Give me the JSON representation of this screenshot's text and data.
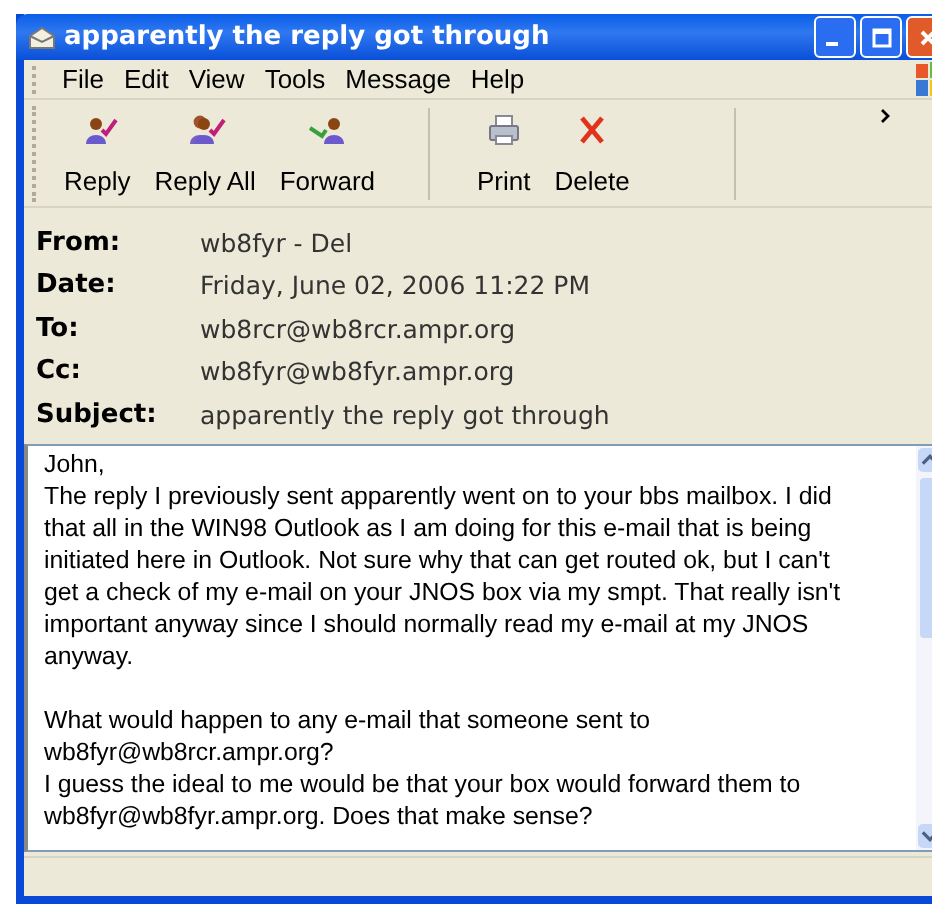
{
  "window": {
    "title": "apparently the reply got through"
  },
  "menu": [
    "File",
    "Edit",
    "View",
    "Tools",
    "Message",
    "Help"
  ],
  "toolbar": [
    {
      "label": "Reply",
      "kind": "reply",
      "separator_after": false
    },
    {
      "label": "Reply All",
      "kind": "reply_all",
      "separator_after": false
    },
    {
      "label": "Forward",
      "kind": "forward",
      "separator_after": true
    },
    {
      "label": "Print",
      "kind": "print",
      "separator_after": false
    },
    {
      "label": "Delete",
      "kind": "delete",
      "separator_after": true
    }
  ],
  "headers": [
    {
      "label": "From:",
      "value": "wb8fyr - Del"
    },
    {
      "label": "Date:",
      "value": "Friday, June 02, 2006 11:22 PM"
    },
    {
      "label": "To:",
      "value": "wb8rcr@wb8rcr.ampr.org"
    },
    {
      "label": "Cc:",
      "value": "wb8fyr@wb8fyr.ampr.org"
    },
    {
      "label": "Subject:",
      "value": "apparently the reply got through"
    }
  ],
  "body": {
    "paragraphs": [
      [
        "John,",
        "The reply I previously sent apparently went on to your bbs mailbox. I did",
        "that all in the WIN98 Outlook as I am doing for this e-mail that is being",
        "initiated here in Outlook. Not sure why that can get routed ok, but I can't",
        "get a check of my e-mail on your JNOS box via my smpt. That really isn't",
        "important anyway since I should normally read my e-mail at my JNOS",
        "anyway."
      ],
      [
        "What would happen to any e-mail that someone sent to",
        "wb8fyr@wb8rcr.ampr.org?",
        "I guess the ideal to me would be that your box would forward them to",
        "wb8fyr@wb8fyr.ampr.org. Does that make sense?"
      ]
    ]
  }
}
